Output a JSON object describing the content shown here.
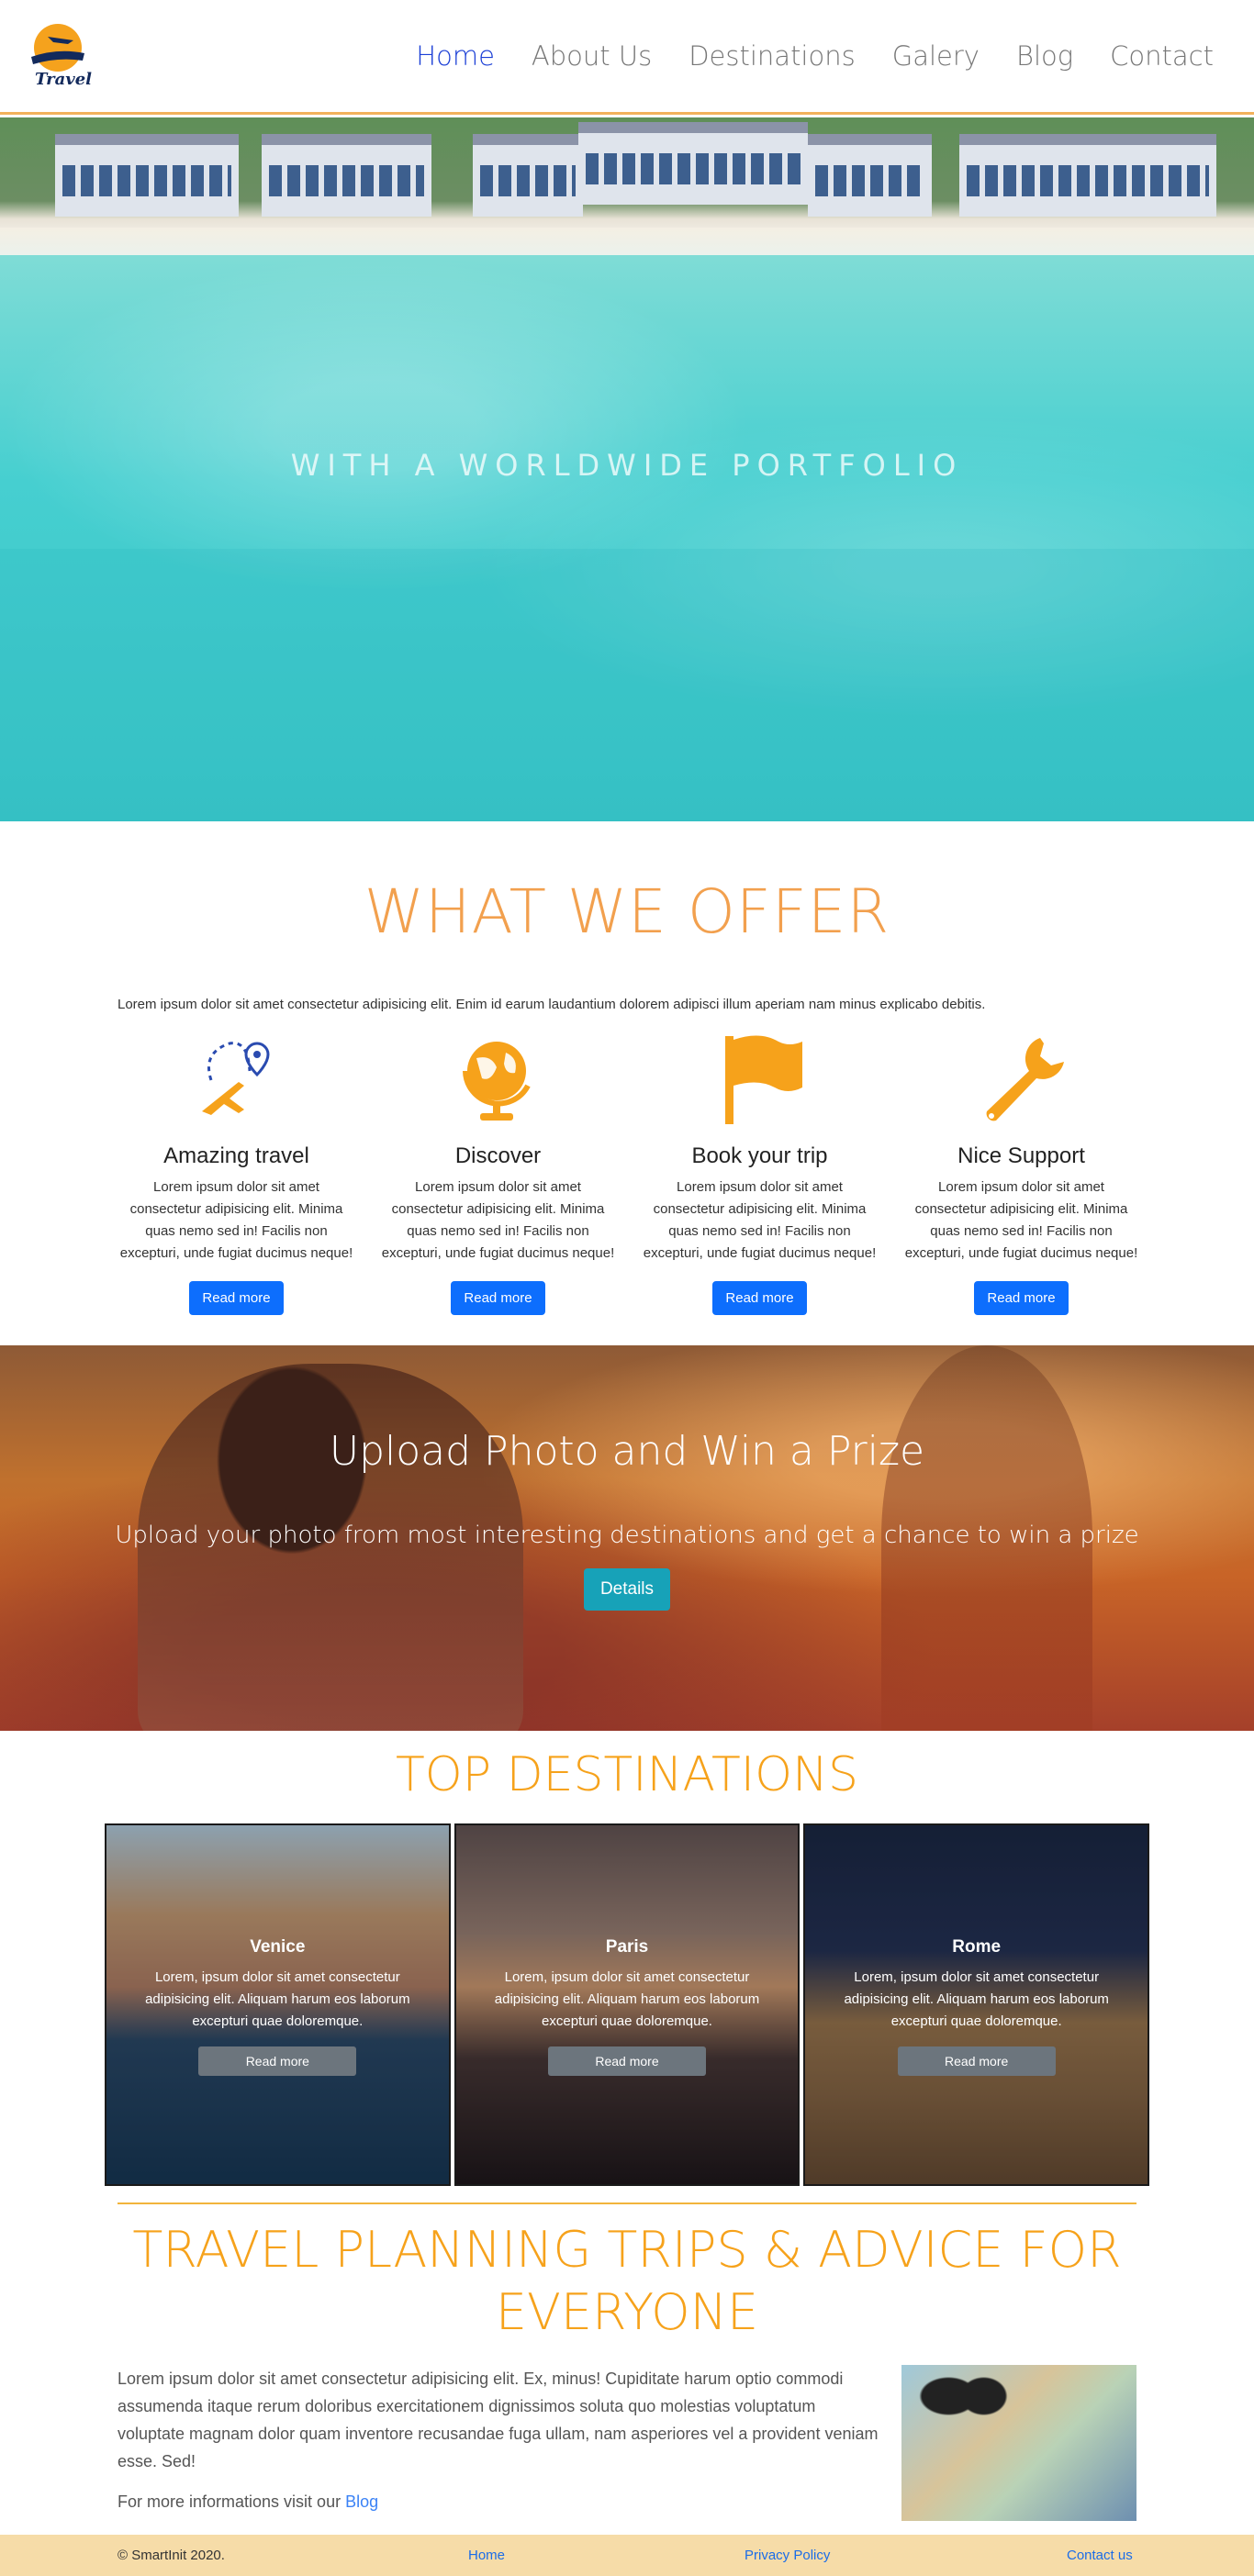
{
  "nav": {
    "logo_text": "Travel",
    "items": [
      {
        "label": "Home",
        "active": true
      },
      {
        "label": "About Us",
        "active": false
      },
      {
        "label": "Destinations",
        "active": false
      },
      {
        "label": "Galery",
        "active": false
      },
      {
        "label": "Blog",
        "active": false
      },
      {
        "label": "Contact",
        "active": false
      }
    ]
  },
  "hero": {
    "tagline": "WITH A WORLDWIDE PORTFOLIO"
  },
  "offer": {
    "title": "WHAT WE OFFER",
    "intro": "Lorem ipsum dolor sit amet consectetur adipisicing elit. Enim id earum laudantium dolorem adipisci illum aperiam nam minus explicabo debitis.",
    "features": [
      {
        "title": "Amazing travel",
        "icon": "travel-route-icon",
        "text": "Lorem ipsum dolor sit amet consectetur adipisicing elit. Minima quas nemo sed in! Facilis non excepturi, unde fugiat ducimus neque!",
        "button": "Read more"
      },
      {
        "title": "Discover",
        "icon": "globe-icon",
        "text": "Lorem ipsum dolor sit amet consectetur adipisicing elit. Minima quas nemo sed in! Facilis non excepturi, unde fugiat ducimus neque!",
        "button": "Read more"
      },
      {
        "title": "Book your trip",
        "icon": "flag-icon",
        "text": "Lorem ipsum dolor sit amet consectetur adipisicing elit. Minima quas nemo sed in! Facilis non excepturi, unde fugiat ducimus neque!",
        "button": "Read more"
      },
      {
        "title": "Nice Support",
        "icon": "wrench-icon",
        "text": "Lorem ipsum dolor sit amet consectetur adipisicing elit. Minima quas nemo sed in! Facilis non excepturi, unde fugiat ducimus neque!",
        "button": "Read more"
      }
    ]
  },
  "prize": {
    "title": "Upload Photo and Win a Prize",
    "subtitle": "Upload your photo from most interesting destinations and get a chance to win a prize",
    "button": "Details"
  },
  "destinations": {
    "title": "TOP DESTINATIONS",
    "cards": [
      {
        "name": "Venice",
        "text": "Lorem, ipsum dolor sit amet consectetur adipisicing elit. Aliquam harum eos laborum excepturi quae doloremque.",
        "button": "Read more"
      },
      {
        "name": "Paris",
        "text": "Lorem, ipsum dolor sit amet consectetur adipisicing elit. Aliquam harum eos laborum excepturi quae doloremque.",
        "button": "Read more"
      },
      {
        "name": "Rome",
        "text": "Lorem, ipsum dolor sit amet consectetur adipisicing elit. Aliquam harum eos laborum excepturi quae doloremque.",
        "button": "Read more"
      }
    ]
  },
  "travel": {
    "title": "TRAVEL PLANNING TRIPS & ADVICE FOR EVERYONE",
    "text": "Lorem ipsum dolor sit amet consectetur adipisicing elit. Ex, minus! Cupiditate harum optio commodi assumenda itaque rerum doloribus exercitationem dignissimos soluta quo molestias voluptatum voluptate magnam dolor quam inventore recusandae fuga ullam, nam asperiores vel a provident veniam esse. Sed!",
    "more_prefix": "For more informations visit our",
    "more_link": "Blog"
  },
  "footer": {
    "copyright": "© SmartInit 2020.",
    "home": "Home",
    "privacy": "Privacy Policy",
    "contact": "Contact us"
  },
  "colors": {
    "accent_orange": "#f6a21b",
    "primary_blue": "#0d6efd",
    "info_teal": "#17a2b8",
    "nav_active": "#1b3fd6",
    "footer_bg": "#f6dca8"
  }
}
